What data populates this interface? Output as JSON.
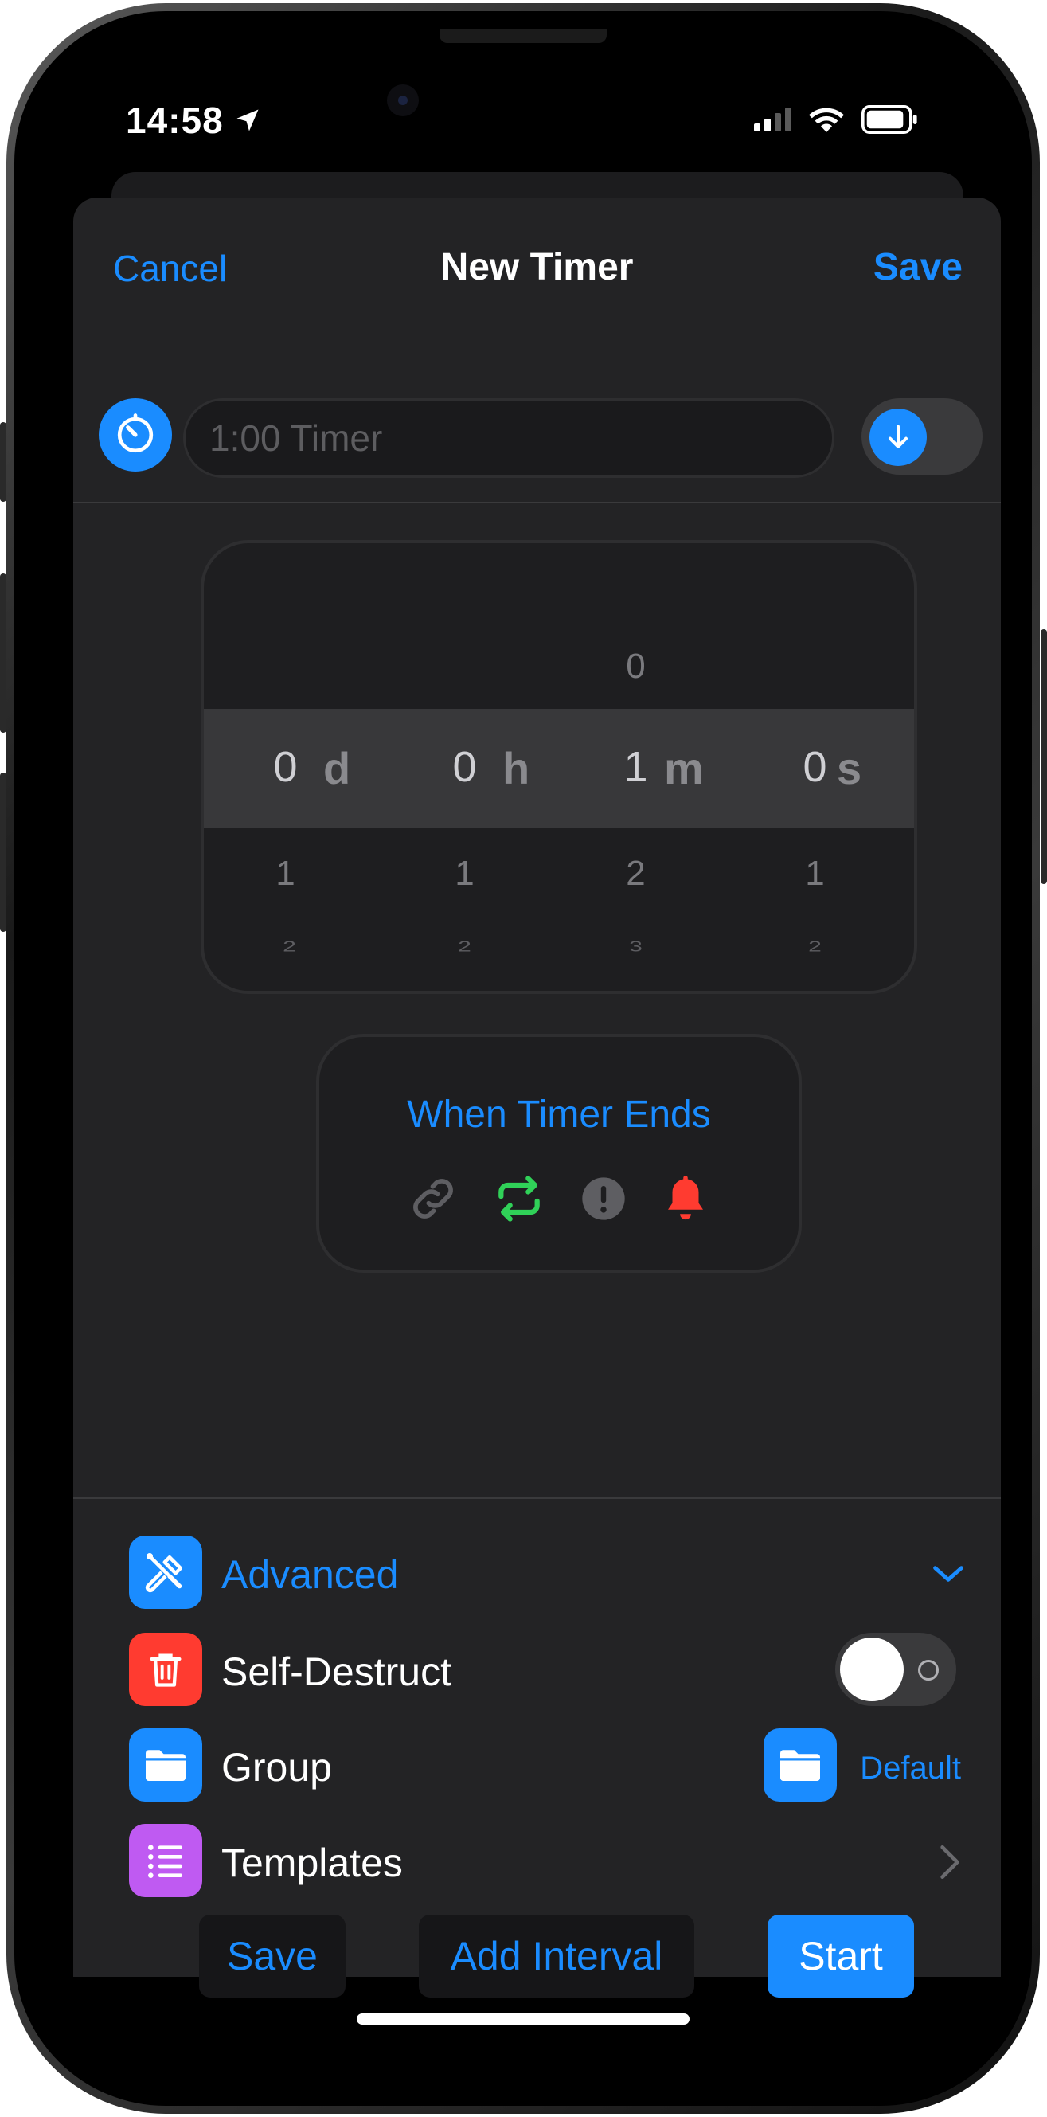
{
  "status": {
    "time": "14:58"
  },
  "nav": {
    "cancel": "Cancel",
    "title": "New Timer",
    "save": "Save"
  },
  "name_field": {
    "placeholder": "1:00 Timer"
  },
  "picker": {
    "columns": [
      {
        "unit": "d",
        "selected": "0",
        "above": "",
        "below1": "1",
        "below2": "2"
      },
      {
        "unit": "h",
        "selected": "0",
        "above": "",
        "below1": "1",
        "below2": "2"
      },
      {
        "unit": "m",
        "selected": "1",
        "above": "0",
        "below1": "2",
        "below2": "3"
      },
      {
        "unit": "s",
        "selected": "0",
        "above": "",
        "below1": "1",
        "below2": "2"
      }
    ]
  },
  "when_timer_ends": {
    "title": "When Timer Ends",
    "icons": [
      "link-icon",
      "repeat-icon",
      "alert-icon",
      "bell-icon"
    ]
  },
  "advanced": {
    "label": "Advanced"
  },
  "self_destruct": {
    "label": "Self-Destruct",
    "enabled": false
  },
  "group": {
    "label": "Group",
    "value": "Default"
  },
  "templates": {
    "label": "Templates"
  },
  "actions": {
    "save": "Save",
    "add_interval": "Add Interval",
    "start": "Start"
  },
  "colors": {
    "accent": "#1a8cff",
    "destruct_red": "#ff3b30",
    "templates_purple": "#bf5af2",
    "repeat_green": "#30d158"
  }
}
